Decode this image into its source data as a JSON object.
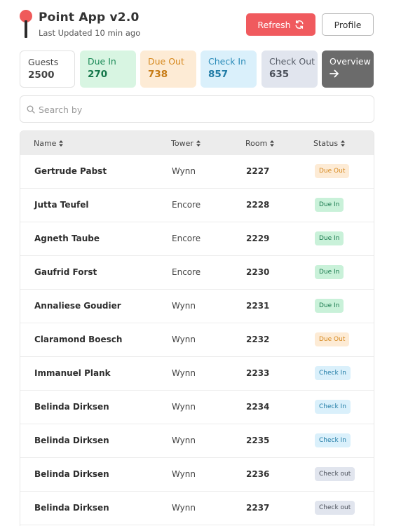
{
  "header": {
    "title": "Point App v2.0",
    "subtitle": "Last Updated 10 min ago",
    "refresh_label": "Refresh",
    "profile_label": "Profile"
  },
  "stats": {
    "guests": {
      "label": "Guests",
      "value": "2500"
    },
    "due_in": {
      "label": "Due In",
      "value": "270"
    },
    "due_out": {
      "label": "Due Out",
      "value": "738"
    },
    "check_in": {
      "label": "Check In",
      "value": "857"
    },
    "check_out": {
      "label": "Check Out",
      "value": "635"
    },
    "overview": {
      "label": "Overview",
      "icon": "arrow-right-icon"
    }
  },
  "search": {
    "placeholder": "Search by",
    "value": ""
  },
  "table": {
    "columns": [
      "Name",
      "Tower",
      "Room",
      "Status"
    ],
    "rows": [
      {
        "name": "Gertrude Pabst",
        "tower": "Wynn",
        "room": "2227",
        "status": "Due Out",
        "status_type": "dueout"
      },
      {
        "name": "Jutta Teufel",
        "tower": "Encore",
        "room": "2228",
        "status": "Due In",
        "status_type": "duein"
      },
      {
        "name": "Agneth Taube",
        "tower": "Encore",
        "room": "2229",
        "status": "Due In",
        "status_type": "duein"
      },
      {
        "name": "Gaufrid Forst",
        "tower": "Encore",
        "room": "2230",
        "status": "Due In",
        "status_type": "duein"
      },
      {
        "name": "Annaliese Goudier",
        "tower": "Wynn",
        "room": "2231",
        "status": "Due In",
        "status_type": "duein"
      },
      {
        "name": "Claramond Boesch",
        "tower": "Wynn",
        "room": "2232",
        "status": "Due Out",
        "status_type": "dueout"
      },
      {
        "name": "Immanuel Plank",
        "tower": "Wynn",
        "room": "2233",
        "status": "Check In",
        "status_type": "checkin"
      },
      {
        "name": "Belinda Dirksen",
        "tower": "Wynn",
        "room": "2234",
        "status": "Check In",
        "status_type": "checkin"
      },
      {
        "name": "Belinda Dirksen",
        "tower": "Wynn",
        "room": "2235",
        "status": "Check In",
        "status_type": "checkin"
      },
      {
        "name": "Belinda Dirksen",
        "tower": "Wynn",
        "room": "2236",
        "status": "Check out",
        "status_type": "checkout"
      },
      {
        "name": "Belinda Dirksen",
        "tower": "Wynn",
        "room": "2237",
        "status": "Check out",
        "status_type": "checkout"
      }
    ]
  },
  "colors": {
    "accent_red": "#f05a5e",
    "due_in": "#16784b",
    "due_out": "#d6891f",
    "check_in": "#217ca6",
    "check_out": "#4b505a",
    "overview_bg": "#6b6b6b"
  }
}
